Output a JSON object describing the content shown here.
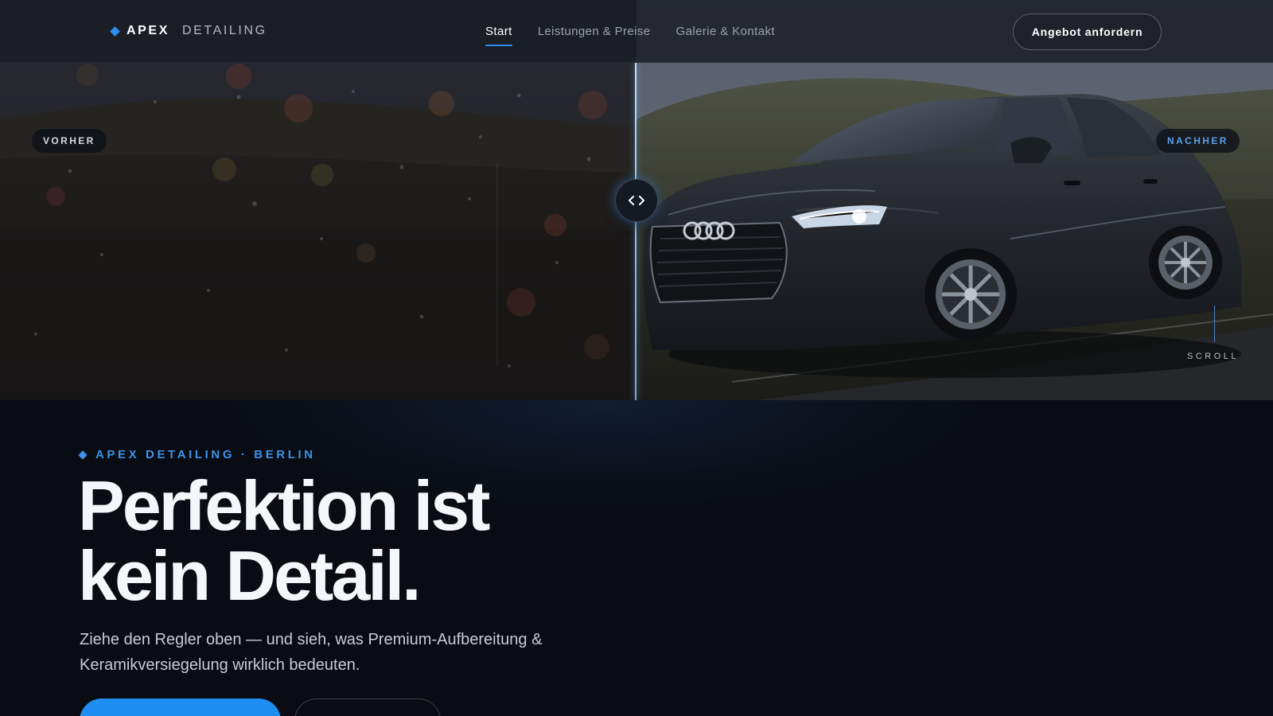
{
  "nav": {
    "brand_bold": "APEX",
    "brand_light": "DETAILING",
    "links": [
      {
        "label": "Start",
        "active": true
      },
      {
        "label": "Leistungen & Preise",
        "active": false
      },
      {
        "label": "Galerie & Kontakt",
        "active": false
      }
    ],
    "cta_label": "Angebot anfordern"
  },
  "compare": {
    "before_label": "VORHER",
    "after_label": "NACHHER",
    "slider_position": 0.5,
    "scroll_label": "SCROLL"
  },
  "hero": {
    "eyebrow": "APEX DETAILING · BERLIN",
    "headline_line1": "Perfektion ist",
    "headline_line2": "kein Detail.",
    "subtext": "Ziehe den Regler oben — und sieh, was Premium-Aufbereitung & Keramikversiegelung wirklich bedeuten.",
    "primary_button": "",
    "secondary_button": ""
  },
  "colors": {
    "accent": "#1e8ef2",
    "background": "#090c12",
    "nav_bg": "#1a1c24",
    "after_label": "#5aa0e8"
  },
  "icons": {
    "brand": "diamond-icon",
    "handle": "chevrons-left-right-icon"
  }
}
